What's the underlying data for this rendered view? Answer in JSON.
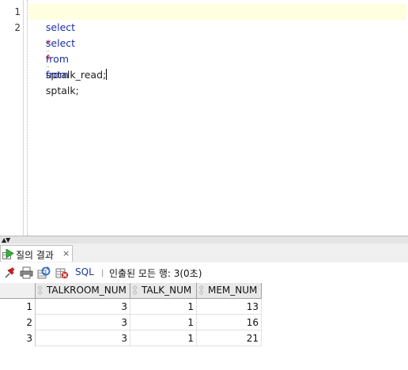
{
  "editor": {
    "line_numbers": [
      "1",
      "2"
    ],
    "lines": [
      {
        "kw1": "select",
        "star": "*",
        "kw2": "from",
        "rest": "sptalk_read;"
      },
      {
        "kw1": "select",
        "star": "*",
        "kw2": "from",
        "rest": "sptalk;"
      }
    ]
  },
  "results_tab": {
    "label": "질의 결과",
    "close": "×"
  },
  "toolbar": {
    "sql_label": "SQL",
    "separator": "|",
    "status": "인출된 모든 행: 3(0초)"
  },
  "grid": {
    "columns": [
      "TALKROOM_NUM",
      "TALK_NUM",
      "MEM_NUM"
    ],
    "rows": [
      {
        "index": "1",
        "cells": [
          "3",
          "1",
          "13"
        ]
      },
      {
        "index": "2",
        "cells": [
          "3",
          "1",
          "16"
        ]
      },
      {
        "index": "3",
        "cells": [
          "3",
          "1",
          "21"
        ]
      }
    ]
  },
  "colors": {
    "keyword": "#1c2fa8",
    "current_line": "#ffffe0",
    "header_bg": "#e8e8e8"
  }
}
